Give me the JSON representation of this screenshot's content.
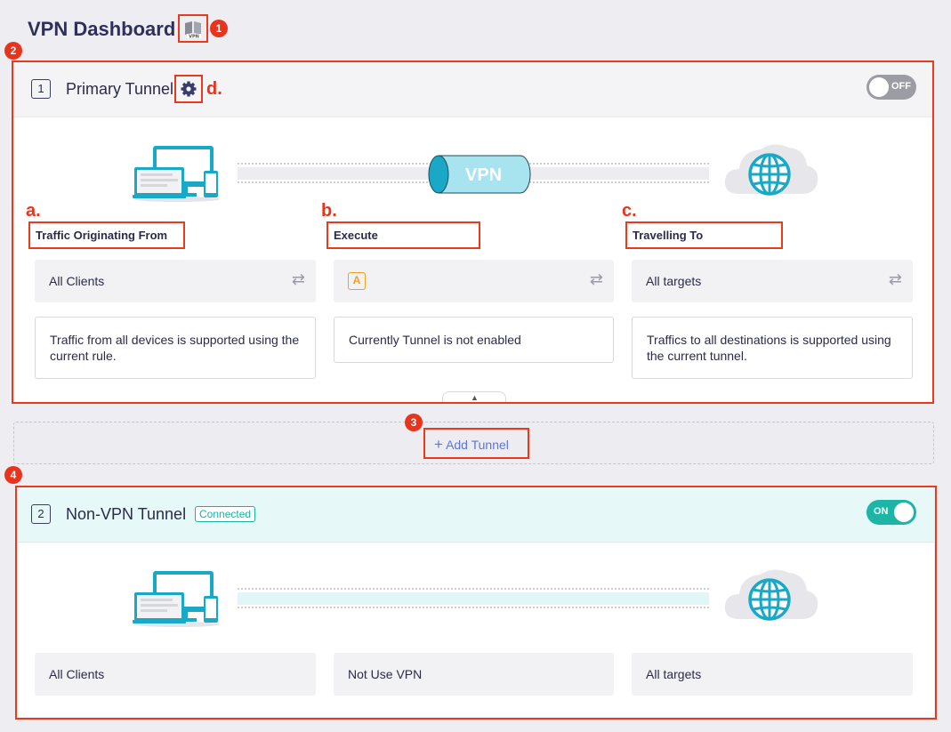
{
  "header": {
    "title": "VPN Dashboard",
    "icon": "vpn-book-icon"
  },
  "annotations": {
    "badge1": "1",
    "badge2": "2",
    "badge3": "3",
    "badge4": "4",
    "letter_a": "a.",
    "letter_b": "b.",
    "letter_c": "c.",
    "letter_d": "d."
  },
  "tunnel1": {
    "number": "1",
    "title": "Primary Tunnel",
    "toggle_label": "OFF",
    "vpn_label": "VPN",
    "columns": [
      {
        "label": "Traffic Originating From",
        "value": "All Clients",
        "description": "Traffic from all devices is supported using the current rule."
      },
      {
        "label": "Execute",
        "value": "A",
        "description": "Currently Tunnel is not enabled"
      },
      {
        "label": "Travelling To",
        "value": "All targets",
        "description": "Traffics to all destinations is supported using the current tunnel."
      }
    ]
  },
  "add_tunnel": {
    "label": "Add Tunnel"
  },
  "tunnel2": {
    "number": "2",
    "title": "Non-VPN Tunnel",
    "status": "Connected",
    "toggle_label": "ON",
    "columns": [
      {
        "value": "All Clients"
      },
      {
        "value": "Not Use VPN"
      },
      {
        "value": "All targets"
      }
    ]
  },
  "colors": {
    "accent_red": "#e8341c",
    "teal": "#1cb5a6",
    "link_blue": "#5b75d8",
    "globe": "#1aa8c7"
  }
}
